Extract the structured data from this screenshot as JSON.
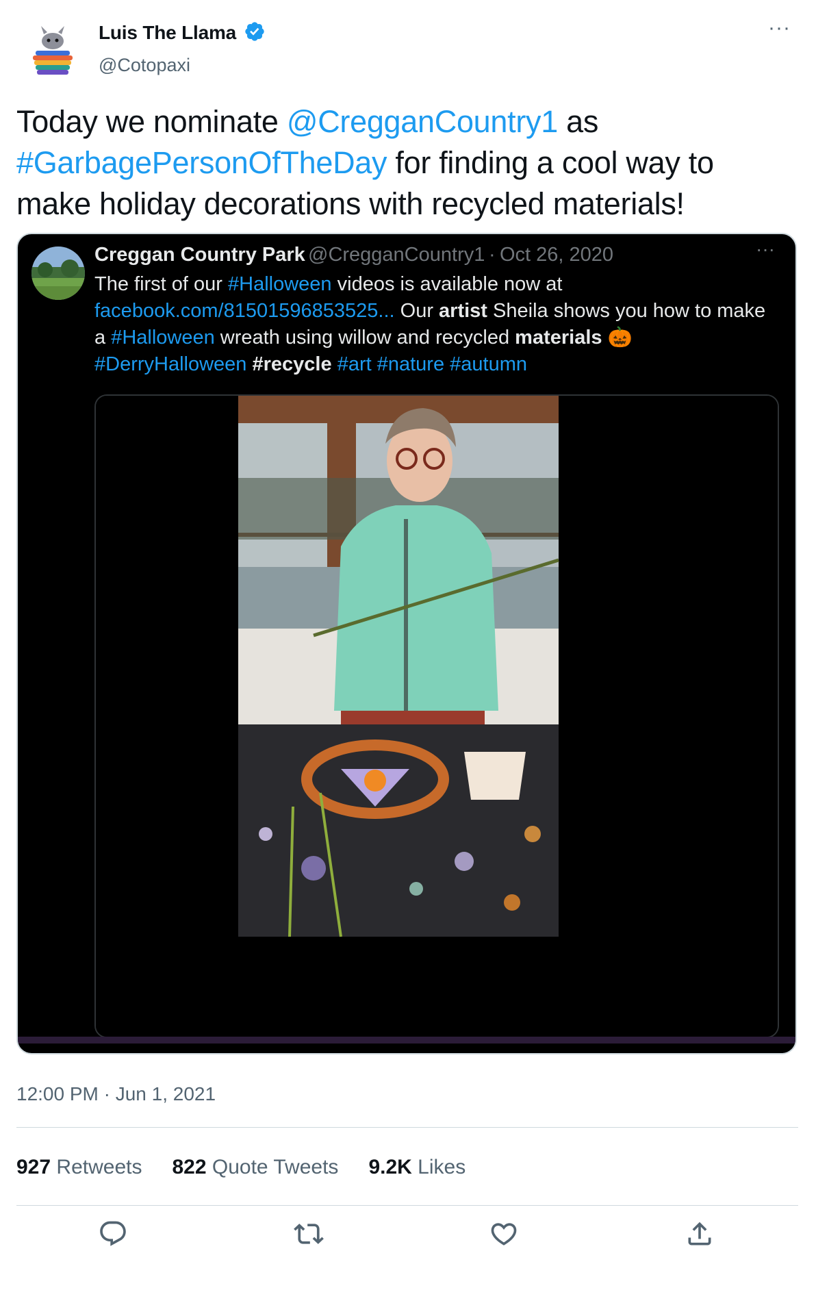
{
  "author": {
    "name": "Luis The Llama",
    "handle": "@Cotopaxi",
    "verified_icon": "verified-badge-icon",
    "more_label": "···"
  },
  "tweet": {
    "text_before": "Today we nominate ",
    "mention": "@CregganCountry1",
    "text_mid": " as ",
    "hashtag": "#GarbagePersonOfTheDay",
    "text_after": " for finding a cool way to make holiday decorations with recycled materials!"
  },
  "quoted": {
    "name": "Creggan Country Park",
    "handle": "@CregganCountry1",
    "separator": "·",
    "date": "Oct 26, 2020",
    "more_label": "···",
    "text": {
      "p1": "The first of our ",
      "tag_halloween": "#Halloween",
      "p2": " videos is available now at ",
      "url": "facebook.com/81501596853525...",
      "p3": " Our ",
      "bold_artist": "artist",
      "p4": " Sheila shows you how to make a ",
      "tag_halloween2": "#Halloween",
      "p5": " wreath using willow and recycled ",
      "bold_materials": "materials",
      "emoji": "🎃",
      "tag_derry": "#DerryHalloween",
      "tag_recycle": "#recycle",
      "tag_art": "#art",
      "tag_nature": "#nature",
      "tag_autumn": "#autumn"
    }
  },
  "timestamp": "12:00 PM · Jun 1, 2021",
  "stats": {
    "retweets_count": "927",
    "retweets_label": "Retweets",
    "quotes_count": "822",
    "quotes_label": "Quote Tweets",
    "likes_count": "9.2K",
    "likes_label": "Likes"
  },
  "actions": [
    "reply-icon",
    "retweet-icon",
    "like-icon",
    "share-icon"
  ],
  "colors": {
    "link": "#1d9bf0",
    "secondary_text": "#536471",
    "quoted_bg": "#000000"
  }
}
